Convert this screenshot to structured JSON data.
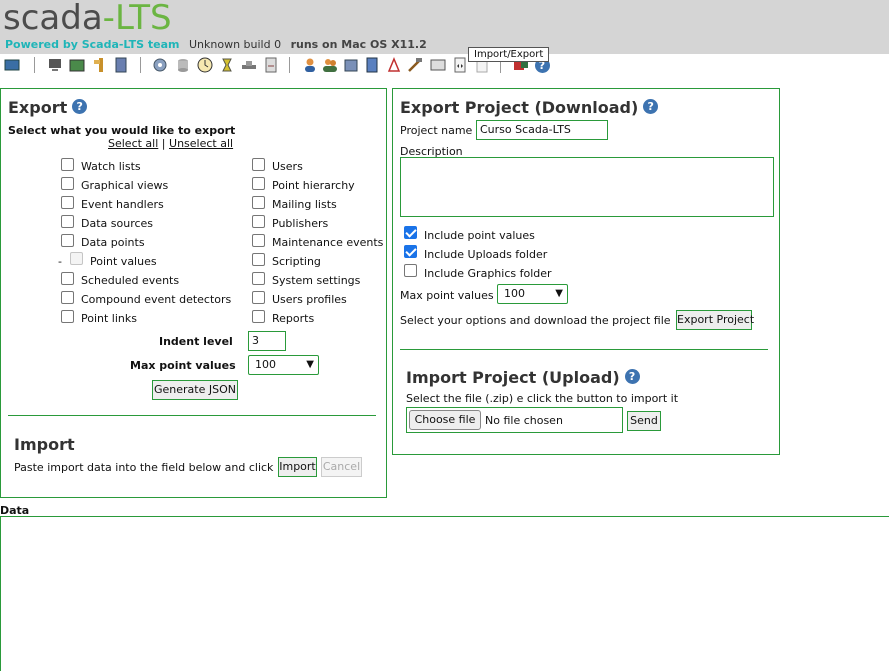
{
  "header": {
    "logo_part1": "scada",
    "logo_part2": "-LTS",
    "powered_by": "Powered by Scada-LTS team",
    "build": "Unknown build 0",
    "runs_on": "runs on Mac OS X11.2"
  },
  "toolbar": {
    "tooltip": "Import/Export",
    "icons": [
      "monitor-icon",
      "watchlist-icon",
      "graphical-views-icon",
      "event-handlers-icon",
      "reports-icon",
      "data-sources-icon",
      "point-hierarchy-icon",
      "scheduled-icon",
      "compound-icon",
      "publishers-icon",
      "users-icon",
      "user-profiles-icon",
      "mailing-lists-icon",
      "maintenance-icon",
      "sql-icon",
      "system-settings-icon",
      "import-export-icon",
      "logout-icon",
      "help-icon"
    ]
  },
  "export": {
    "title": "Export",
    "help": "?",
    "prompt": "Select what you would like to export",
    "select_all": "Select all",
    "divider": "|",
    "unselect_all": "Unselect all",
    "left_items": [
      "Watch lists",
      "Graphical views",
      "Event handlers",
      "Data sources",
      "Data points",
      "Point values",
      "Scheduled events",
      "Compound event detectors",
      "Point links"
    ],
    "right_items": [
      "Users",
      "Point hierarchy",
      "Mailing lists",
      "Publishers",
      "Maintenance events",
      "Scripting",
      "System settings",
      "Users profiles",
      "Reports"
    ],
    "point_values_dash": "-",
    "indent_label": "Indent level",
    "indent_value": "3",
    "max_label": "Max point values",
    "max_value": "100",
    "generate_button": "Generate JSON"
  },
  "import": {
    "title": "Import",
    "instructions": "Paste import data into the field below and click",
    "import_button": "Import",
    "cancel_button": "Cancel"
  },
  "project_export": {
    "title": "Export Project (Download)",
    "help": "?",
    "name_label": "Project name",
    "name_value": "Curso Scada-LTS",
    "description_label": "Description",
    "include_point_values": "Include point values",
    "include_uploads": "Include Uploads folder",
    "include_graphics": "Include Graphics folder",
    "max_label": "Max point values",
    "max_value": "100",
    "download_text": "Select your options and download the project file",
    "export_button": "Export Project"
  },
  "project_import": {
    "title": "Import Project (Upload)",
    "help": "?",
    "instructions": "Select the file (.zip) e click the button to import it",
    "choose_button": "Choose file",
    "no_file": "No file chosen",
    "send_button": "Send"
  },
  "data": {
    "label": "Data"
  }
}
